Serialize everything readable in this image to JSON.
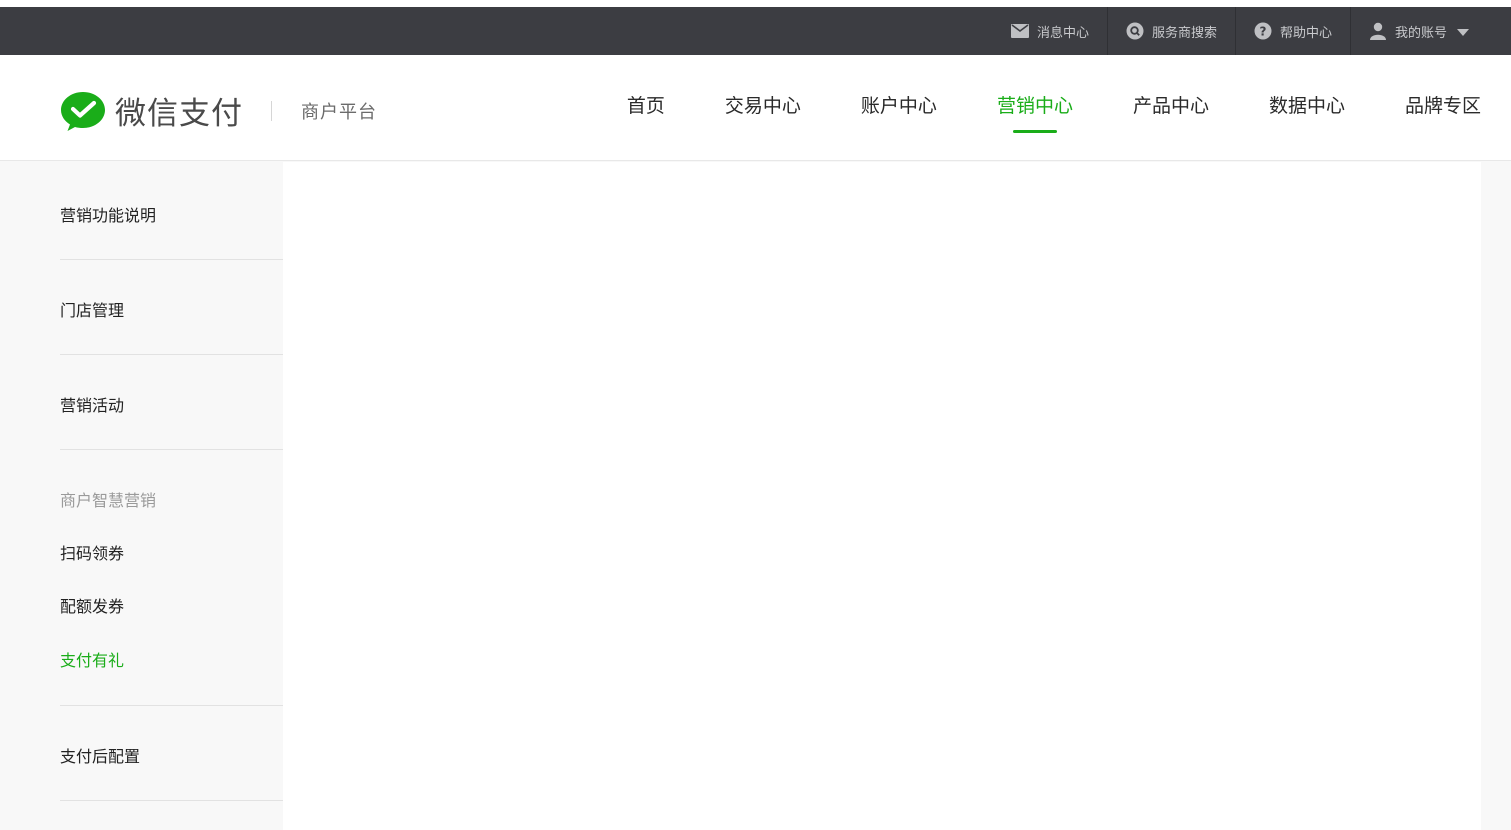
{
  "topbar": {
    "items": [
      {
        "label": "消息中心",
        "icon": "mail-icon"
      },
      {
        "label": "服务商搜索",
        "icon": "search-icon"
      },
      {
        "label": "帮助中心",
        "icon": "help-icon"
      },
      {
        "label": "我的账号",
        "icon": "user-icon"
      }
    ]
  },
  "header": {
    "logo_text": "微信支付",
    "logo_sub": "商户平台",
    "nav": [
      {
        "label": "首页"
      },
      {
        "label": "交易中心"
      },
      {
        "label": "账户中心"
      },
      {
        "label": "营销中心",
        "active": true
      },
      {
        "label": "产品中心"
      },
      {
        "label": "数据中心"
      },
      {
        "label": "品牌专区"
      }
    ]
  },
  "sidebar": {
    "item_0": "营销功能说明",
    "item_1": "门店管理",
    "item_2": "营销活动",
    "group_heading": "商户智慧营销",
    "group_links": [
      "扫码领券",
      "配额发券",
      "支付有礼"
    ],
    "active_link": "支付有礼",
    "item_3": "支付后配置"
  },
  "colors": {
    "accent": "#1aad19",
    "topbar_bg": "#3c3d42",
    "sidebar_bg": "#f8f8f8"
  }
}
